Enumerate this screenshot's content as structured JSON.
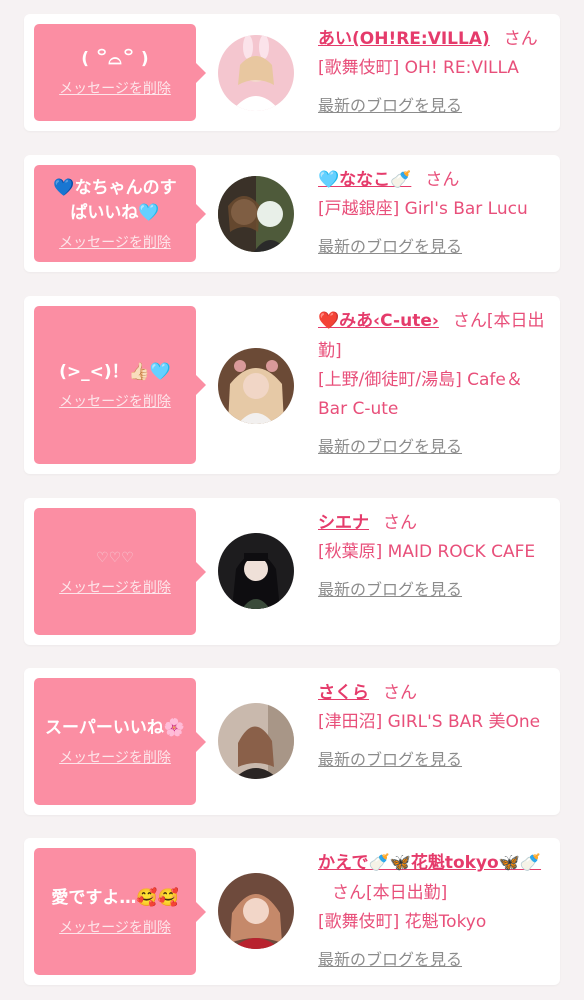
{
  "delete_label": "メッセージを削除",
  "blog_label": "最新のブログを見る",
  "san": "さん",
  "colors": {
    "accent": "#e53b6b",
    "bubble": "#fb8ea3",
    "link_gray": "#8c8c8c"
  },
  "items": [
    {
      "message": "( ꒪⌓꒪ )",
      "name": "あい(OH!RE:VILLA)",
      "suffix": "さん",
      "shop": "[歌舞伎町] OH! RE:VILLA"
    },
    {
      "message": "💙なちゃんのすぱいいね🩵",
      "name": "🩵ななこ🍼",
      "suffix": "さん",
      "shop": "[戸越銀座] Girl's Bar Lucu"
    },
    {
      "message": "(>_<)！👍🏻🩵",
      "name": "❤️みあ‹C-ute›",
      "suffix": "さん[本日出勤]",
      "shop": "[上野/御徒町/湯島] Cafe＆Bar C-ute"
    },
    {
      "message": "♡♡♡",
      "name": "シエナ",
      "suffix": "さん",
      "shop": "[秋葉原] MAID ROCK CAFE"
    },
    {
      "message": "スーパーいいね🌸",
      "name": "さくら",
      "suffix": "さん",
      "shop": "[津田沼] GIRL'S BAR 美One"
    },
    {
      "message": "愛ですよ…🥰🥰",
      "name": "かえで🍼🦋花魁tokyo🦋🍼",
      "suffix": "さん[本日出勤]",
      "shop": "[歌舞伎町] 花魁Tokyo"
    }
  ]
}
